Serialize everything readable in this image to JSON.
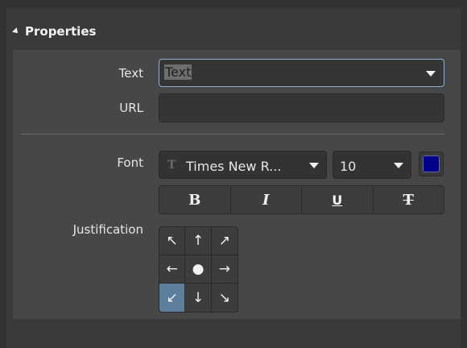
{
  "section": {
    "title": "Properties"
  },
  "fields": {
    "text_label": "Text",
    "text_value": "Text",
    "url_label": "URL",
    "url_value": ""
  },
  "font": {
    "label": "Font",
    "family": "Times New R...",
    "size": "10",
    "color": "#00008b",
    "font_icon": "T"
  },
  "styles": {
    "bold": "B",
    "italic": "I",
    "underline": "U",
    "strikethrough": "T"
  },
  "justification": {
    "label": "Justification",
    "selected": "bottom-left",
    "cells": [
      {
        "name": "top-left",
        "glyph": "↖"
      },
      {
        "name": "top-center",
        "glyph": "↑"
      },
      {
        "name": "top-right",
        "glyph": "↗"
      },
      {
        "name": "middle-left",
        "glyph": "←"
      },
      {
        "name": "center",
        "glyph": "●"
      },
      {
        "name": "middle-right",
        "glyph": "→"
      },
      {
        "name": "bottom-left",
        "glyph": "↙"
      },
      {
        "name": "bottom-center",
        "glyph": "↓"
      },
      {
        "name": "bottom-right",
        "glyph": "↘"
      }
    ]
  }
}
